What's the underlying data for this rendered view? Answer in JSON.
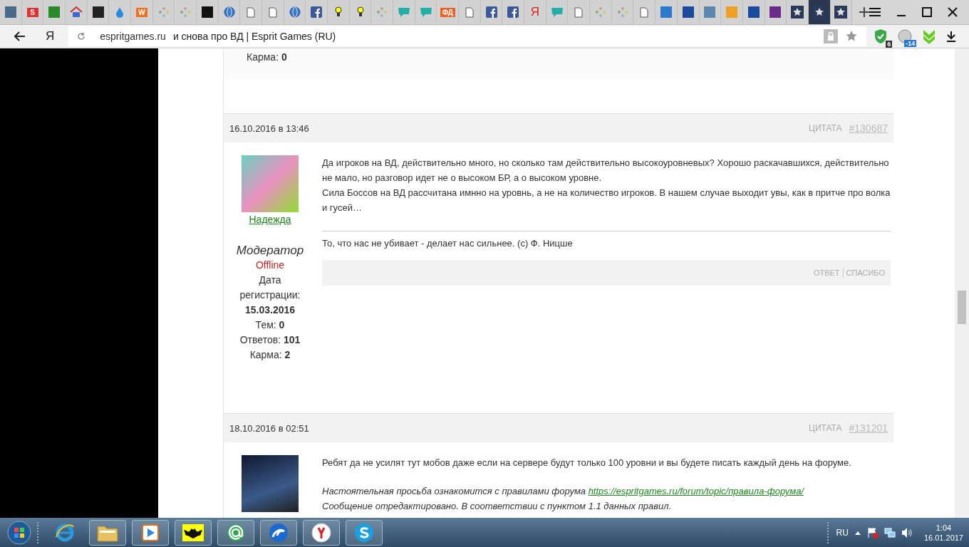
{
  "tabs": [
    {
      "kind": "tile",
      "color": "#4a6a8a",
      "selected": false
    },
    {
      "kind": "letter",
      "glyph": "S",
      "color": "#e03030",
      "selected": false
    },
    {
      "kind": "tile",
      "color": "#2a8a2a",
      "selected": false
    },
    {
      "kind": "house",
      "selected": false
    },
    {
      "kind": "tile",
      "color": "#222222",
      "selected": false
    },
    {
      "kind": "drop",
      "selected": false
    },
    {
      "kind": "letter",
      "glyph": "W",
      "color": "#f07020",
      "selected": false
    },
    {
      "kind": "dots",
      "selected": false
    },
    {
      "kind": "dots",
      "selected": false
    },
    {
      "kind": "tile",
      "color": "#111111",
      "selected": false
    },
    {
      "kind": "globe",
      "selected": false
    },
    {
      "kind": "page",
      "selected": false
    },
    {
      "kind": "page",
      "selected": false
    },
    {
      "kind": "globe",
      "selected": false
    },
    {
      "kind": "facebook",
      "selected": false
    },
    {
      "kind": "bulb",
      "selected": false
    },
    {
      "kind": "bulb",
      "selected": false
    },
    {
      "kind": "dots",
      "selected": false
    },
    {
      "kind": "chat",
      "selected": false
    },
    {
      "kind": "chat",
      "selected": false
    },
    {
      "kind": "letter",
      "glyph": "ФД",
      "color": "#f06020",
      "selected": false
    },
    {
      "kind": "page",
      "selected": false
    },
    {
      "kind": "facebook",
      "selected": false
    },
    {
      "kind": "facebook",
      "selected": false
    },
    {
      "kind": "yandex",
      "glyph": "Я",
      "selected": false
    },
    {
      "kind": "chat",
      "selected": false
    },
    {
      "kind": "page",
      "selected": false
    },
    {
      "kind": "dots",
      "selected": false
    },
    {
      "kind": "dots",
      "selected": false
    },
    {
      "kind": "page",
      "selected": false
    },
    {
      "kind": "tile",
      "color": "#2a7ad0",
      "selected": false
    },
    {
      "kind": "tile",
      "color": "#1a4a9a",
      "selected": false
    },
    {
      "kind": "tile",
      "color": "#5a86b0",
      "selected": false
    },
    {
      "kind": "tile",
      "color": "#f0a020",
      "selected": false
    },
    {
      "kind": "tile",
      "color": "#1a4a9a",
      "selected": false
    },
    {
      "kind": "tile",
      "color": "#6a2a8a",
      "selected": false
    },
    {
      "kind": "star",
      "selected": false
    },
    {
      "kind": "star",
      "selected": true
    },
    {
      "kind": "star",
      "selected": false
    }
  ],
  "address_bar": {
    "browser_logo": "Я",
    "domain": "espritgames.ru",
    "title": "и снова про ВД | Esprit Games (RU)",
    "extension_badges": [
      "6",
      "-14"
    ]
  },
  "posts": [
    {
      "kind": "partial",
      "stats": [
        "Карма: **0**"
      ]
    },
    {
      "kind": "full",
      "date": "16.10.2016 в 13:46",
      "quote": "ЦИТАТА",
      "number": "#130687",
      "author": {
        "name": "Надежда",
        "role": "Модератор",
        "status": "Offline",
        "stats": [
          "Дата регистрации:",
          "**15.03.2016**",
          "Тем: **0**",
          "Ответов: **101**",
          "Карма: **2**"
        ]
      },
      "body": [
        {
          "kind": "text",
          "text": "Да игроков на ВД, действительно много, но сколько там действительно высокоуровневых? Хорошо раскачавшихся, действительно не мало, но разговор идет не о высоком БР, а о высоком уровне."
        },
        {
          "kind": "text",
          "text": "Сила Боссов на ВД рассчитана имнно на уровнь, а не на количество игроков. В нашем случае выходит увы, как в притче про волка и гусей…"
        }
      ],
      "signature": "То, что нас не убивает - делает нас сильнее. (с) Ф. Ницше",
      "actions": [
        "ОТВЕТ",
        "СПАСИБО"
      ]
    },
    {
      "kind": "full",
      "date": "18.10.2016 в 02:51",
      "quote": "ЦИТАТА",
      "number": "#131201",
      "body": [
        {
          "kind": "text",
          "text": "Ребят да не усилят тут мобов даже если на сервере будут только 100 уровни и вы будете писать каждый день на форуме."
        },
        {
          "kind": "note",
          "text": "Настоятельная просьба ознакомится с правилами форума",
          "link": "https://espritgames.ru/forum/topic/правила-форума/"
        },
        {
          "kind": "edit",
          "text": "Сообщение отредактировано. В соответствии с пунктом 1.1 данных правил."
        }
      ]
    }
  ],
  "taskbar": {
    "apps": [
      {
        "kind": "ie",
        "running": false
      },
      {
        "kind": "folder",
        "running": true
      },
      {
        "kind": "media",
        "running": true
      },
      {
        "kind": "bat",
        "running": true
      },
      {
        "kind": "mail",
        "running": true
      },
      {
        "kind": "swirl",
        "running": true
      },
      {
        "kind": "yandex",
        "running": true
      },
      {
        "kind": "skype",
        "running": true
      }
    ],
    "language": "RU",
    "time": "1:04",
    "date": "16.01.2017"
  }
}
